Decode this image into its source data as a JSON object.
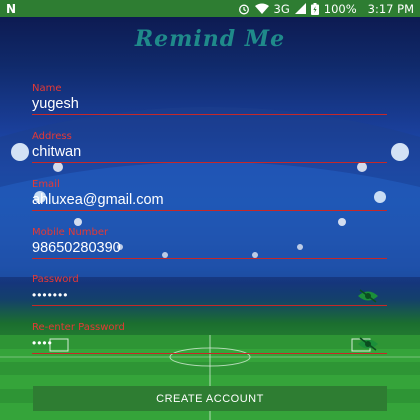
{
  "status_bar": {
    "network": "3G",
    "battery": "100%",
    "time": "3:17 PM"
  },
  "app": {
    "title": "Remind Me"
  },
  "form": {
    "name": {
      "label": "Name",
      "value": "yugesh"
    },
    "address": {
      "label": "Address",
      "value": "chitwan"
    },
    "email": {
      "label": "Email",
      "value": "ahluxea@gmail.com"
    },
    "mobile": {
      "label": "Mobile Number",
      "value": "98650280390"
    },
    "password": {
      "label": "Password",
      "value": "•••••••"
    },
    "reenter_password": {
      "label": "Re-enter Password",
      "value": "••••"
    }
  },
  "button": {
    "create_label": "CREATE ACCOUNT"
  },
  "colors": {
    "accent": "#2e7d32",
    "label": "#e53935",
    "underline": "#c62828",
    "title": "#1f8a8a"
  },
  "icons": [
    "signal-icon",
    "alarm-icon",
    "wifi-icon",
    "battery-icon",
    "eye-icon"
  ]
}
